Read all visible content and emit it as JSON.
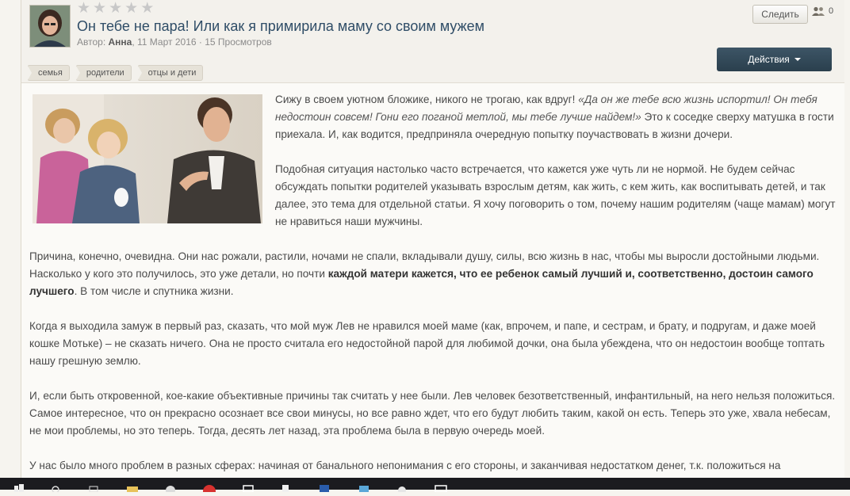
{
  "post": {
    "title": "Он тебе не пара! Или как я примирила маму со своим мужем",
    "author_prefix": "Автор: ",
    "author": "Анна",
    "date": ", 11 Март 2016",
    "views": " · 15 Просмотров",
    "rating_stars": 5,
    "tags": [
      "семья",
      "родители",
      "отцы и дети"
    ]
  },
  "controls": {
    "follow_label": "Следить",
    "followers_count": "0",
    "actions_label": "Действия"
  },
  "body": {
    "p1_a": "Сижу в своем уютном бложике, никого не трогаю, как вдруг! ",
    "p1_quote": "«Да он же тебе всю жизнь испортил! Он тебя недостоин совсем! Гони его поганой метлой, мы тебе лучше найдем!»",
    "p1_b": " Это к соседке сверху матушка в гости приехала. И, как водится, предприняла очередную попытку поучаствовать в жизни дочери.",
    "p2": "Подобная ситуация настолько часто встречается, что кажется уже чуть ли не нормой. Не будем сейчас обсуждать попытки родителей указывать взрослым детям, как жить, с кем жить, как воспитывать детей, и так далее, это тема для отдельной статьи. Я хочу поговорить о том, почему нашим родителям (чаще мамам) могут не нравиться наши мужчины.",
    "p3_a": "Причина, конечно, очевидна. Они нас рожали, растили, ночами не спали, вкладывали душу, силы, всю жизнь в нас, чтобы мы выросли достойными людьми. Насколько у кого это получилось, это уже детали, но почти ",
    "p3_bold": "каждой матери кажется, что ее ребенок самый лучший и, соответственно, достоин самого лучшего",
    "p3_b": ". В том числе и спутника жизни.",
    "p4": "Когда я выходила замуж в первый раз, сказать, что мой муж Лев не нравился моей маме (как, впрочем, и папе, и сестрам, и брату, и подругам, и даже моей кошке Мотьке) – не сказать ничего. Она не просто считала его недостойной парой для любимой дочки, она была убеждена, что он недостоин вообще топтать нашу грешную землю.",
    "p5": "И, если быть откровенной, кое-какие объективные причины так считать у нее были. Лев человек безответственный, инфантильный, на него нельзя положиться. Самое интересное, что он прекрасно осознает все свои минусы, но все равно ждет, что его будут любить таким, какой он есть. Теперь это уже, хвала небесам, не мои проблемы, но это теперь. Тогда, десять лет назад, эта проблема была в первую очередь моей.",
    "p6": "У нас было много проблем в разных сферах: начиная от банального непонимания с его стороны, и заканчивая недостатком денег, т.к. положиться на"
  }
}
